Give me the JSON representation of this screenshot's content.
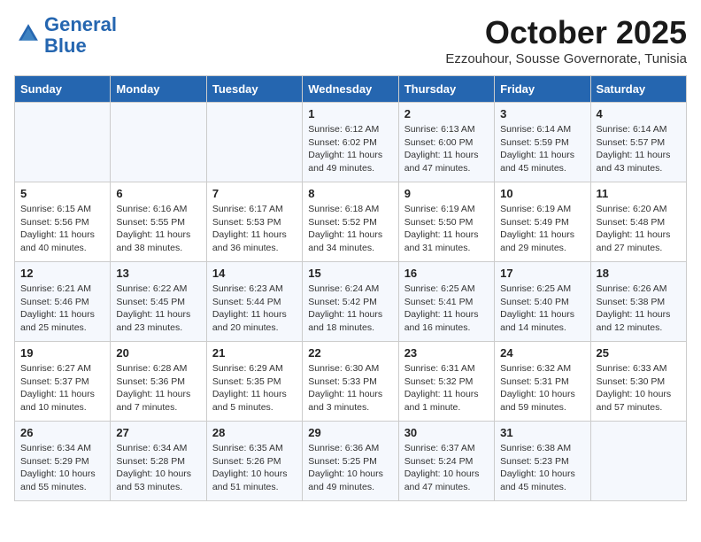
{
  "logo": {
    "line1": "General",
    "line2": "Blue"
  },
  "title": "October 2025",
  "location": "Ezzouhour, Sousse Governorate, Tunisia",
  "days_of_week": [
    "Sunday",
    "Monday",
    "Tuesday",
    "Wednesday",
    "Thursday",
    "Friday",
    "Saturday"
  ],
  "weeks": [
    [
      {
        "day": "",
        "info": ""
      },
      {
        "day": "",
        "info": ""
      },
      {
        "day": "",
        "info": ""
      },
      {
        "day": "1",
        "info": "Sunrise: 6:12 AM\nSunset: 6:02 PM\nDaylight: 11 hours\nand 49 minutes."
      },
      {
        "day": "2",
        "info": "Sunrise: 6:13 AM\nSunset: 6:00 PM\nDaylight: 11 hours\nand 47 minutes."
      },
      {
        "day": "3",
        "info": "Sunrise: 6:14 AM\nSunset: 5:59 PM\nDaylight: 11 hours\nand 45 minutes."
      },
      {
        "day": "4",
        "info": "Sunrise: 6:14 AM\nSunset: 5:57 PM\nDaylight: 11 hours\nand 43 minutes."
      }
    ],
    [
      {
        "day": "5",
        "info": "Sunrise: 6:15 AM\nSunset: 5:56 PM\nDaylight: 11 hours\nand 40 minutes."
      },
      {
        "day": "6",
        "info": "Sunrise: 6:16 AM\nSunset: 5:55 PM\nDaylight: 11 hours\nand 38 minutes."
      },
      {
        "day": "7",
        "info": "Sunrise: 6:17 AM\nSunset: 5:53 PM\nDaylight: 11 hours\nand 36 minutes."
      },
      {
        "day": "8",
        "info": "Sunrise: 6:18 AM\nSunset: 5:52 PM\nDaylight: 11 hours\nand 34 minutes."
      },
      {
        "day": "9",
        "info": "Sunrise: 6:19 AM\nSunset: 5:50 PM\nDaylight: 11 hours\nand 31 minutes."
      },
      {
        "day": "10",
        "info": "Sunrise: 6:19 AM\nSunset: 5:49 PM\nDaylight: 11 hours\nand 29 minutes."
      },
      {
        "day": "11",
        "info": "Sunrise: 6:20 AM\nSunset: 5:48 PM\nDaylight: 11 hours\nand 27 minutes."
      }
    ],
    [
      {
        "day": "12",
        "info": "Sunrise: 6:21 AM\nSunset: 5:46 PM\nDaylight: 11 hours\nand 25 minutes."
      },
      {
        "day": "13",
        "info": "Sunrise: 6:22 AM\nSunset: 5:45 PM\nDaylight: 11 hours\nand 23 minutes."
      },
      {
        "day": "14",
        "info": "Sunrise: 6:23 AM\nSunset: 5:44 PM\nDaylight: 11 hours\nand 20 minutes."
      },
      {
        "day": "15",
        "info": "Sunrise: 6:24 AM\nSunset: 5:42 PM\nDaylight: 11 hours\nand 18 minutes."
      },
      {
        "day": "16",
        "info": "Sunrise: 6:25 AM\nSunset: 5:41 PM\nDaylight: 11 hours\nand 16 minutes."
      },
      {
        "day": "17",
        "info": "Sunrise: 6:25 AM\nSunset: 5:40 PM\nDaylight: 11 hours\nand 14 minutes."
      },
      {
        "day": "18",
        "info": "Sunrise: 6:26 AM\nSunset: 5:38 PM\nDaylight: 11 hours\nand 12 minutes."
      }
    ],
    [
      {
        "day": "19",
        "info": "Sunrise: 6:27 AM\nSunset: 5:37 PM\nDaylight: 11 hours\nand 10 minutes."
      },
      {
        "day": "20",
        "info": "Sunrise: 6:28 AM\nSunset: 5:36 PM\nDaylight: 11 hours\nand 7 minutes."
      },
      {
        "day": "21",
        "info": "Sunrise: 6:29 AM\nSunset: 5:35 PM\nDaylight: 11 hours\nand 5 minutes."
      },
      {
        "day": "22",
        "info": "Sunrise: 6:30 AM\nSunset: 5:33 PM\nDaylight: 11 hours\nand 3 minutes."
      },
      {
        "day": "23",
        "info": "Sunrise: 6:31 AM\nSunset: 5:32 PM\nDaylight: 11 hours\nand 1 minute."
      },
      {
        "day": "24",
        "info": "Sunrise: 6:32 AM\nSunset: 5:31 PM\nDaylight: 10 hours\nand 59 minutes."
      },
      {
        "day": "25",
        "info": "Sunrise: 6:33 AM\nSunset: 5:30 PM\nDaylight: 10 hours\nand 57 minutes."
      }
    ],
    [
      {
        "day": "26",
        "info": "Sunrise: 6:34 AM\nSunset: 5:29 PM\nDaylight: 10 hours\nand 55 minutes."
      },
      {
        "day": "27",
        "info": "Sunrise: 6:34 AM\nSunset: 5:28 PM\nDaylight: 10 hours\nand 53 minutes."
      },
      {
        "day": "28",
        "info": "Sunrise: 6:35 AM\nSunset: 5:26 PM\nDaylight: 10 hours\nand 51 minutes."
      },
      {
        "day": "29",
        "info": "Sunrise: 6:36 AM\nSunset: 5:25 PM\nDaylight: 10 hours\nand 49 minutes."
      },
      {
        "day": "30",
        "info": "Sunrise: 6:37 AM\nSunset: 5:24 PM\nDaylight: 10 hours\nand 47 minutes."
      },
      {
        "day": "31",
        "info": "Sunrise: 6:38 AM\nSunset: 5:23 PM\nDaylight: 10 hours\nand 45 minutes."
      },
      {
        "day": "",
        "info": ""
      }
    ]
  ]
}
